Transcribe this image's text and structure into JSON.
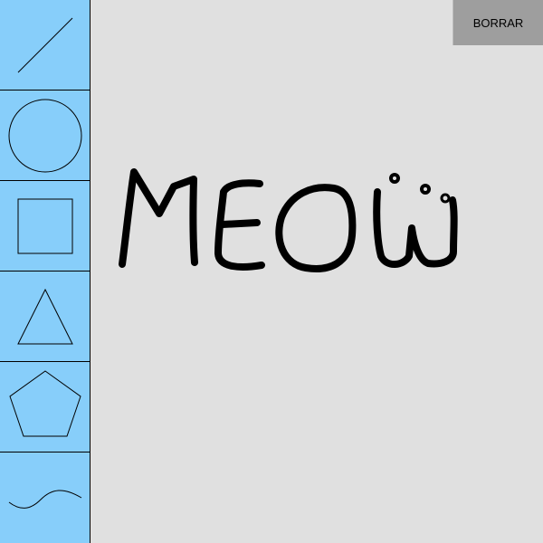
{
  "toolbar": {
    "background": "#87cefa",
    "tools": [
      {
        "name": "line-tool",
        "icon": "line-icon"
      },
      {
        "name": "circle-tool",
        "icon": "circle-icon"
      },
      {
        "name": "square-tool",
        "icon": "square-icon"
      },
      {
        "name": "triangle-tool",
        "icon": "triangle-icon"
      },
      {
        "name": "pentagon-tool",
        "icon": "pentagon-icon"
      },
      {
        "name": "freehand-tool",
        "icon": "wave-icon"
      }
    ]
  },
  "canvas": {
    "background": "#e0e0e0",
    "drawing_text": "MEOW",
    "stroke_color": "#000000"
  },
  "clear_button": {
    "label": "BORRAR",
    "background": "#9e9e9e"
  }
}
